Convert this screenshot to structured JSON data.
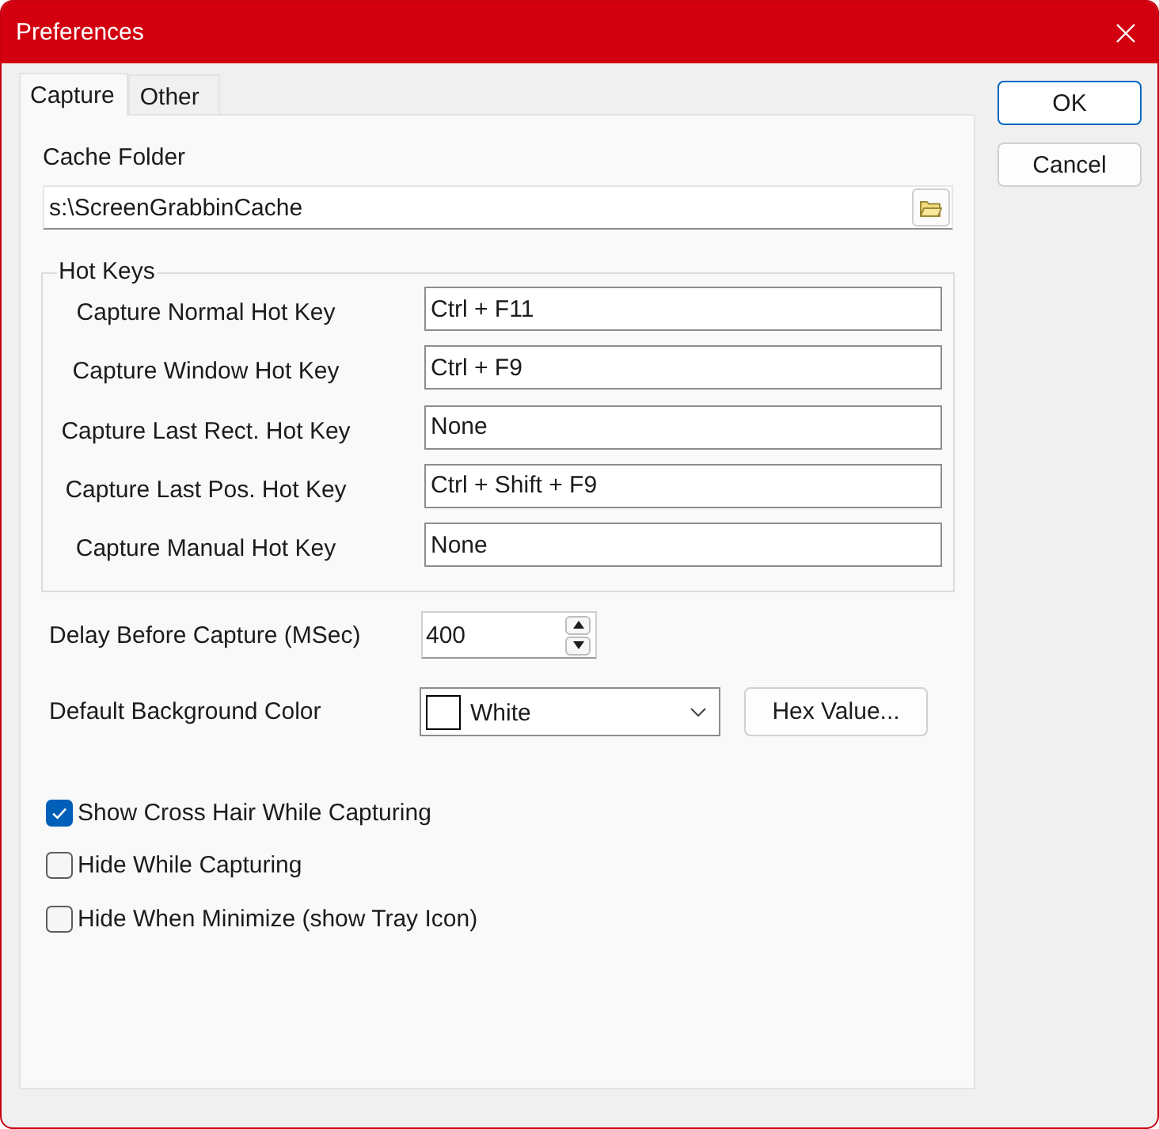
{
  "window": {
    "title": "Preferences"
  },
  "tabs": [
    {
      "label": "Capture",
      "selected": true
    },
    {
      "label": "Other",
      "selected": false
    }
  ],
  "cache_folder": {
    "label": "Cache Folder",
    "value": "s:\\ScreenGrabbinCache"
  },
  "hot_keys": {
    "title": "Hot Keys",
    "rows": [
      {
        "label": "Capture Normal Hot Key",
        "value": "Ctrl + F11"
      },
      {
        "label": "Capture Window Hot Key",
        "value": "Ctrl + F9"
      },
      {
        "label": "Capture Last Rect. Hot Key",
        "value": "None"
      },
      {
        "label": "Capture Last Pos. Hot Key",
        "value": "Ctrl + Shift + F9"
      },
      {
        "label": "Capture Manual Hot Key",
        "value": "None"
      }
    ]
  },
  "delay": {
    "label": "Delay Before Capture (MSec)",
    "value": "400"
  },
  "background_color": {
    "label": "Default Background Color",
    "value": "White",
    "button": "Hex Value..."
  },
  "options": [
    {
      "label": "Show Cross Hair While Capturing",
      "checked": true
    },
    {
      "label": "Hide While Capturing",
      "checked": false
    },
    {
      "label": "Hide When Minimize (show Tray Icon)",
      "checked": false
    }
  ],
  "dialog_buttons": [
    {
      "label": "OK",
      "default": true
    },
    {
      "label": "Cancel",
      "default": false
    }
  ]
}
